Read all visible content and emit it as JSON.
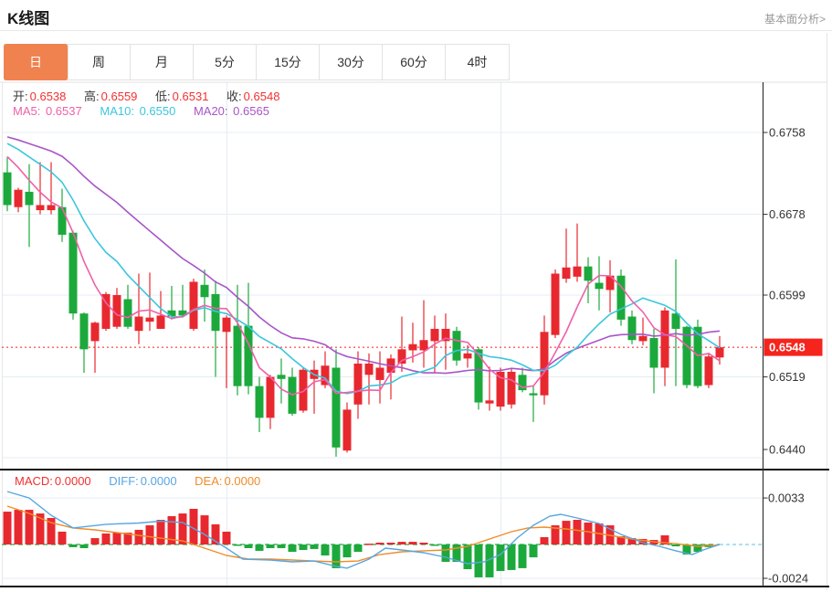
{
  "header": {
    "title": "K线图",
    "link": "基本面分析>"
  },
  "tabs": {
    "items": [
      "日",
      "周",
      "月",
      "5分",
      "15分",
      "30分",
      "60分",
      "4时"
    ],
    "active": 0
  },
  "legend": {
    "ohlc": [
      {
        "label": "开:",
        "value": "0.6538"
      },
      {
        "label": "高:",
        "value": "0.6559"
      },
      {
        "label": "低:",
        "value": "0.6531"
      },
      {
        "label": "收:",
        "value": "0.6548"
      }
    ],
    "ma": [
      {
        "label": "MA5:",
        "value": "0.6537"
      },
      {
        "label": "MA10:",
        "value": "0.6550"
      },
      {
        "label": "MA20:",
        "value": "0.6565"
      }
    ],
    "macd": [
      {
        "label": "MACD:",
        "value": "0.0000"
      },
      {
        "label": "DIFF:",
        "value": "0.0000"
      },
      {
        "label": "DEA:",
        "value": "0.0000"
      }
    ]
  },
  "axis": {
    "price_badge": "0.6548",
    "macd_ticks": [
      "0.0033",
      "-0.0024"
    ]
  },
  "colors": {
    "up": "#e8282f",
    "down": "#1ca93c",
    "ma5": "#f060a8",
    "ma10": "#3cc6dc",
    "ma20": "#a855c8",
    "diff": "#58a6e0",
    "dea": "#f08c28",
    "grid": "#e4edf4",
    "dotted": "#f51f1f",
    "badge": "#f5241c",
    "axis": "#333333",
    "tab_accent": "#f0824f",
    "value_red": "#f23030",
    "zero_dash": "#2aa84a",
    "zero_dash_ext": "#7ecfe8"
  },
  "chart_data": {
    "type": "candlestick",
    "title": "K线图",
    "interval": "日",
    "legend_position": "top-left",
    "grid": true,
    "price_axis": [
      0.6758,
      0.6678,
      0.6599,
      0.6519,
      0.644
    ],
    "last_price": 0.6548,
    "ohlc_current": {
      "open": 0.6538,
      "high": 0.6559,
      "low": 0.6531,
      "close": 0.6548
    },
    "ma_current": {
      "MA5": 0.6537,
      "MA10": 0.655,
      "MA20": 0.6565
    },
    "candles": [
      [
        0.6719,
        0.6734,
        0.6681,
        0.6687
      ],
      [
        0.6685,
        0.6704,
        0.668,
        0.6702
      ],
      [
        0.67,
        0.6727,
        0.6646,
        0.6687
      ],
      [
        0.6682,
        0.6729,
        0.6678,
        0.6687
      ],
      [
        0.6682,
        0.6729,
        0.6678,
        0.6687
      ],
      [
        0.6685,
        0.6703,
        0.6651,
        0.6658
      ],
      [
        0.666,
        0.6662,
        0.6575,
        0.6581
      ],
      [
        0.6581,
        0.6582,
        0.6523,
        0.6546
      ],
      [
        0.6554,
        0.6573,
        0.6523,
        0.6572
      ],
      [
        0.6566,
        0.6602,
        0.6564,
        0.66
      ],
      [
        0.6568,
        0.6606,
        0.6566,
        0.6599
      ],
      [
        0.6595,
        0.6609,
        0.6566,
        0.6568
      ],
      [
        0.6564,
        0.662,
        0.6551,
        0.6578
      ],
      [
        0.6573,
        0.6621,
        0.6564,
        0.6577
      ],
      [
        0.6566,
        0.6603,
        0.6566,
        0.6579
      ],
      [
        0.6584,
        0.6608,
        0.6575,
        0.6578
      ],
      [
        0.6584,
        0.6609,
        0.6577,
        0.6579
      ],
      [
        0.6566,
        0.6615,
        0.6564,
        0.6612
      ],
      [
        0.6609,
        0.6624,
        0.6573,
        0.6597
      ],
      [
        0.66,
        0.6613,
        0.6519,
        0.6564
      ],
      [
        0.6563,
        0.6579,
        0.6508,
        0.6577
      ],
      [
        0.6569,
        0.6609,
        0.6501,
        0.651
      ],
      [
        0.6569,
        0.6611,
        0.6502,
        0.651
      ],
      [
        0.651,
        0.6519,
        0.6465,
        0.6479
      ],
      [
        0.6479,
        0.6521,
        0.6468,
        0.6519
      ],
      [
        0.6521,
        0.6537,
        0.6493,
        0.6517
      ],
      [
        0.6519,
        0.6528,
        0.6481,
        0.6483
      ],
      [
        0.6486,
        0.6528,
        0.6484,
        0.6526
      ],
      [
        0.6517,
        0.6535,
        0.6483,
        0.6526
      ],
      [
        0.6511,
        0.6544,
        0.6508,
        0.653
      ],
      [
        0.6528,
        0.6546,
        0.6441,
        0.645
      ],
      [
        0.6447,
        0.6494,
        0.6445,
        0.6487
      ],
      [
        0.6492,
        0.6544,
        0.6478,
        0.6532
      ],
      [
        0.6521,
        0.6542,
        0.6492,
        0.6532
      ],
      [
        0.6516,
        0.6544,
        0.6493,
        0.6528
      ],
      [
        0.6523,
        0.6541,
        0.6497,
        0.6537
      ],
      [
        0.6532,
        0.6578,
        0.6524,
        0.6546
      ],
      [
        0.6545,
        0.6572,
        0.6533,
        0.6551
      ],
      [
        0.6545,
        0.6594,
        0.6528,
        0.6555
      ],
      [
        0.6554,
        0.6579,
        0.6523,
        0.6566
      ],
      [
        0.6554,
        0.6581,
        0.6526,
        0.6566
      ],
      [
        0.6564,
        0.6568,
        0.653,
        0.6535
      ],
      [
        0.6537,
        0.655,
        0.6528,
        0.6542
      ],
      [
        0.6546,
        0.6548,
        0.6487,
        0.6494
      ],
      [
        0.6493,
        0.6529,
        0.6486,
        0.6496
      ],
      [
        0.649,
        0.6528,
        0.6486,
        0.6524
      ],
      [
        0.6492,
        0.6528,
        0.6488,
        0.6524
      ],
      [
        0.6521,
        0.6528,
        0.6504,
        0.6506
      ],
      [
        0.6503,
        0.6511,
        0.6475,
        0.6501
      ],
      [
        0.6501,
        0.6579,
        0.6492,
        0.6563
      ],
      [
        0.656,
        0.6624,
        0.6557,
        0.662
      ],
      [
        0.6615,
        0.6664,
        0.6611,
        0.6626
      ],
      [
        0.6617,
        0.6669,
        0.6612,
        0.6627
      ],
      [
        0.6627,
        0.6636,
        0.6591,
        0.6613
      ],
      [
        0.6611,
        0.6637,
        0.6584,
        0.6605
      ],
      [
        0.6604,
        0.6633,
        0.6582,
        0.6618
      ],
      [
        0.6618,
        0.6624,
        0.6569,
        0.6575
      ],
      [
        0.6578,
        0.6584,
        0.6551,
        0.6555
      ],
      [
        0.6554,
        0.6577,
        0.655,
        0.6559
      ],
      [
        0.6557,
        0.6566,
        0.6503,
        0.6528
      ],
      [
        0.6528,
        0.6587,
        0.651,
        0.6584
      ],
      [
        0.6581,
        0.6634,
        0.651,
        0.6566
      ],
      [
        0.6568,
        0.6569,
        0.6508,
        0.6511
      ],
      [
        0.6568,
        0.6575,
        0.6508,
        0.651
      ],
      [
        0.6511,
        0.6542,
        0.6508,
        0.6539
      ],
      [
        0.6538,
        0.6559,
        0.6531,
        0.6548
      ]
    ],
    "ma_seed_closes": [
      0.676,
      0.676,
      0.676,
      0.676,
      0.676,
      0.676,
      0.676,
      0.676,
      0.676,
      0.676,
      0.676,
      0.676,
      0.676,
      0.676,
      0.676,
      0.676,
      0.6755,
      0.675,
      0.6745,
      0.6735
    ],
    "macd": {
      "axis": [
        0.0033,
        -0.0024
      ],
      "current": {
        "MACD": 0.0,
        "DIFF": 0.0,
        "DEA": 0.0
      },
      "hist": [
        0.00233,
        0.00246,
        0.00246,
        0.0022,
        0.00188,
        0.00091,
        -0.00019,
        -0.00026,
        0.00045,
        0.00078,
        0.00084,
        0.00084,
        0.00104,
        0.00136,
        0.00175,
        0.00201,
        0.0022,
        0.00253,
        0.00207,
        0.00143,
        0.00091,
        -6e-05,
        -0.00026,
        -0.00045,
        -0.00026,
        -0.00026,
        -0.00052,
        -0.00039,
        -0.00032,
        -0.00078,
        -0.00168,
        -0.00091,
        -0.00052,
        6e-05,
        0.00013,
        0.00013,
        0.00019,
        0.00019,
        0.00013,
        -6e-05,
        -0.00123,
        -0.00123,
        -0.00175,
        -0.00233,
        -0.00233,
        -0.00188,
        -0.00181,
        -0.00168,
        -0.00091,
        0.00052,
        0.00136,
        0.00168,
        0.00175,
        0.00156,
        0.00149,
        0.00136,
        0.00058,
        0.00045,
        0.00039,
        0.00032,
        0.00065,
        -0.00013,
        -0.00071,
        -0.00052,
        -0.00019,
        0.0
      ],
      "diff_points": [
        [
          0,
          0.00376
        ],
        [
          2,
          0.0033
        ],
        [
          4,
          0.00207
        ],
        [
          6,
          0.00117
        ],
        [
          9,
          0.00143
        ],
        [
          12,
          0.00152
        ],
        [
          14,
          0.00165
        ],
        [
          16,
          0.00156
        ],
        [
          18,
          0.00071
        ],
        [
          20,
          -0.00026
        ],
        [
          21.5,
          -0.00104
        ],
        [
          24,
          -0.0011
        ],
        [
          26,
          -0.00123
        ],
        [
          28,
          -0.00117
        ],
        [
          30,
          -0.00155
        ],
        [
          31,
          -0.00168
        ],
        [
          33,
          -0.00104
        ],
        [
          34.5,
          -0.00026
        ],
        [
          36,
          -0.00039
        ],
        [
          38,
          -0.00058
        ],
        [
          40,
          -0.00091
        ],
        [
          42,
          -0.00136
        ],
        [
          43.5,
          -0.00123
        ],
        [
          45,
          -0.00071
        ],
        [
          46.5,
          0.00045
        ],
        [
          48,
          0.00136
        ],
        [
          49.5,
          0.00201
        ],
        [
          50.5,
          0.00214
        ],
        [
          52,
          0.00188
        ],
        [
          54,
          0.00149
        ],
        [
          56,
          0.00071
        ],
        [
          58,
          0.00013
        ],
        [
          59.5,
          -0.00013
        ],
        [
          61,
          -0.00045
        ],
        [
          62.5,
          -0.00071
        ],
        [
          63.5,
          -0.00039
        ],
        [
          65,
          0.0
        ]
      ],
      "dea_points": [
        [
          0,
          0.00272
        ],
        [
          2,
          0.0022
        ],
        [
          4,
          0.00155
        ],
        [
          6,
          0.00117
        ],
        [
          8,
          0.00104
        ],
        [
          10,
          0.00084
        ],
        [
          12,
          0.00065
        ],
        [
          14,
          0.00045
        ],
        [
          16,
          0.00026
        ],
        [
          18,
          -0.00026
        ],
        [
          20,
          -0.00078
        ],
        [
          22,
          -0.00104
        ],
        [
          24,
          -0.00104
        ],
        [
          26,
          -0.0011
        ],
        [
          28,
          -0.00117
        ],
        [
          30,
          -0.00123
        ],
        [
          32,
          -0.00117
        ],
        [
          34,
          -0.00071
        ],
        [
          36,
          -0.00052
        ],
        [
          38,
          -0.00045
        ],
        [
          40,
          -0.00039
        ],
        [
          42,
          -0.00013
        ],
        [
          44,
          0.00039
        ],
        [
          46,
          0.00091
        ],
        [
          47.5,
          0.00117
        ],
        [
          49,
          0.00123
        ],
        [
          51,
          0.0011
        ],
        [
          53,
          0.00091
        ],
        [
          55,
          0.00065
        ],
        [
          57,
          0.00039
        ],
        [
          59,
          0.00019
        ],
        [
          61,
          6e-05
        ],
        [
          63,
          -0.00013
        ],
        [
          64.5,
          -6e-05
        ],
        [
          65,
          0.0
        ]
      ]
    }
  }
}
